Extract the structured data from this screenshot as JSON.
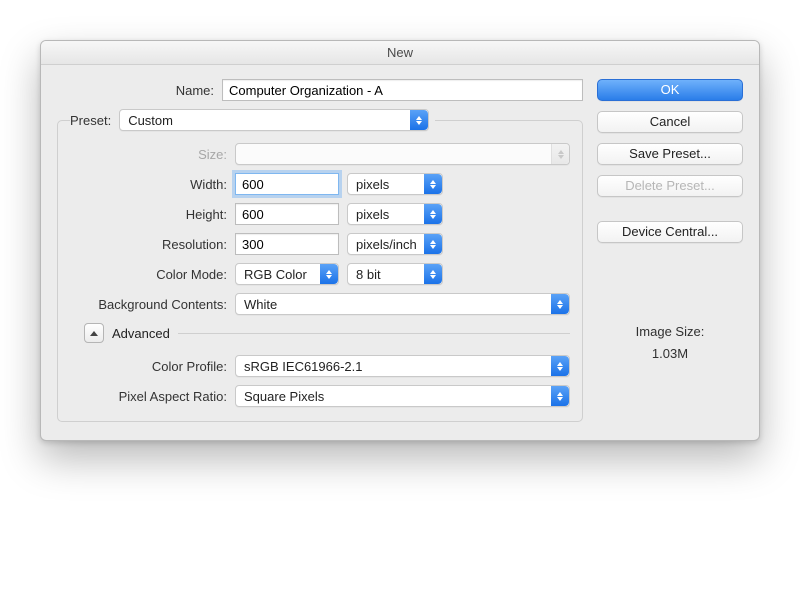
{
  "title": "New",
  "name": {
    "label": "Name:",
    "value": "Computer Organization - A"
  },
  "preset": {
    "label": "Preset:",
    "value": "Custom",
    "size_label": "Size:",
    "size_value": ""
  },
  "width": {
    "label": "Width:",
    "value": "600",
    "unit": "pixels"
  },
  "height": {
    "label": "Height:",
    "value": "600",
    "unit": "pixels"
  },
  "resolution": {
    "label": "Resolution:",
    "value": "300",
    "unit": "pixels/inch"
  },
  "colormode": {
    "label": "Color Mode:",
    "value": "RGB Color",
    "depth": "8 bit"
  },
  "background": {
    "label": "Background Contents:",
    "value": "White"
  },
  "advanced": {
    "label": "Advanced",
    "color_profile": {
      "label": "Color Profile:",
      "value": "sRGB IEC61966-2.1"
    },
    "pixel_aspect": {
      "label": "Pixel Aspect Ratio:",
      "value": "Square Pixels"
    }
  },
  "buttons": {
    "ok": "OK",
    "cancel": "Cancel",
    "save_preset": "Save Preset...",
    "delete_preset": "Delete Preset...",
    "device_central": "Device Central..."
  },
  "image_size": {
    "label": "Image Size:",
    "value": "1.03M"
  }
}
